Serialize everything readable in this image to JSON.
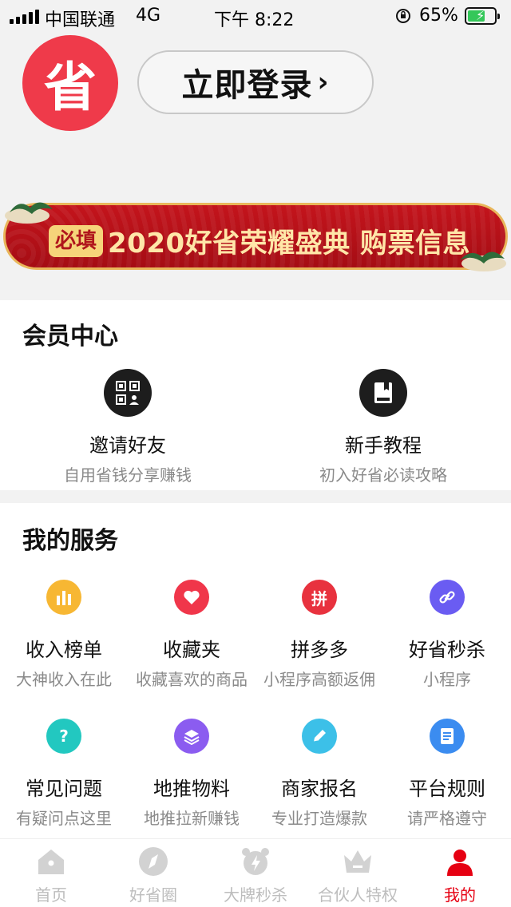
{
  "status_bar": {
    "carrier": "中国联通",
    "network": "4G",
    "time": "下午 8:22",
    "battery_percent": "65%",
    "battery_level": 0.65
  },
  "header": {
    "logo_char": "省",
    "login_label": "立即登录",
    "login_chevron": "›"
  },
  "banner": {
    "tag": "必填",
    "title": "2020好省荣耀盛典 购票信息"
  },
  "member_center": {
    "title": "会员中心",
    "items": [
      {
        "name": "邀请好友",
        "desc": "自用省钱分享赚钱",
        "icon": "qr-code-icon"
      },
      {
        "name": "新手教程",
        "desc": "初入好省必读攻略",
        "icon": "book-icon"
      }
    ]
  },
  "services": {
    "title": "我的服务",
    "items": [
      {
        "name": "收入榜单",
        "desc": "大神收入在此",
        "icon": "bar-chart-icon",
        "color": "#f7b733"
      },
      {
        "name": "收藏夹",
        "desc": "收藏喜欢的商品",
        "icon": "heart-icon",
        "color": "#f0364a"
      },
      {
        "name": "拼多多",
        "desc": "小程序高额返佣",
        "icon": "pinduoduo-icon",
        "color": "#e8323e",
        "glyph": "拼"
      },
      {
        "name": "好省秒杀",
        "desc": "小程序",
        "icon": "link-icon",
        "color": "#6a5cf2"
      },
      {
        "name": "常见问题",
        "desc": "有疑问点这里",
        "icon": "question-icon",
        "color": "#22c8c0",
        "glyph": "?"
      },
      {
        "name": "地推物料",
        "desc": "地推拉新赚钱",
        "icon": "layers-icon",
        "color": "#8b5cf0"
      },
      {
        "name": "商家报名",
        "desc": "专业打造爆款",
        "icon": "pencil-icon",
        "color": "#3cc0e8"
      },
      {
        "name": "平台规则",
        "desc": "请严格遵守",
        "icon": "document-icon",
        "color": "#3b8cf0"
      }
    ]
  },
  "tabbar": {
    "tabs": [
      {
        "label": "首页",
        "icon": "home-icon"
      },
      {
        "label": "好省圈",
        "icon": "compass-icon"
      },
      {
        "label": "大牌秒杀",
        "icon": "alarm-clock-icon"
      },
      {
        "label": "合伙人特权",
        "icon": "crown-icon"
      },
      {
        "label": "我的",
        "icon": "profile-icon",
        "active": true
      }
    ],
    "active_color": "#e60012",
    "inactive_color": "#bdbdbd"
  }
}
